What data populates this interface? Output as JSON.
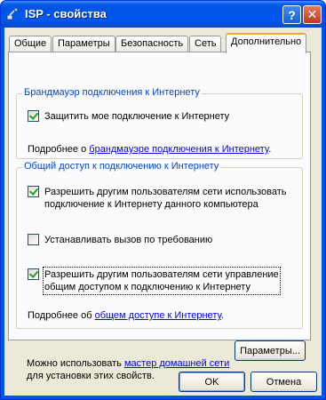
{
  "window": {
    "title": "ISP - свойства",
    "help_label": "?",
    "close_label": "✕"
  },
  "tabs": [
    {
      "label": "Общие"
    },
    {
      "label": "Параметры"
    },
    {
      "label": "Безопасность"
    },
    {
      "label": "Сеть"
    },
    {
      "label": "Дополнительно"
    }
  ],
  "firewall": {
    "title": "Брандмауэр подключения к Интернету",
    "protect_label": "Защитить мое подключение к Интернету",
    "protect_checked": true,
    "more_prefix": "Подробнее о ",
    "more_link": "брандмауэре подключения к Интернету",
    "more_suffix": "."
  },
  "sharing": {
    "title": "Общий доступ к подключению к Интернету",
    "allow_line1": "Разрешить другим пользователям сети использовать",
    "allow_line2": "подключение к Интернету данного компьютера",
    "allow_checked": true,
    "demand_label": "Устанавливать вызов по требованию",
    "demand_checked": false,
    "control_line1": "Разрешить другим пользователям сети управление",
    "control_line2": "общим доступом к подключению к Интернету",
    "control_checked": true,
    "more_prefix": "Подробнее об ",
    "more_link": "общем доступе к Интернету",
    "more_suffix": "."
  },
  "footer": {
    "wizard_prefix": "Можно использовать ",
    "wizard_link": "мастер домашней сети",
    "wizard_line2": "для установки этих свойств.",
    "settings_button": "Параметры..."
  },
  "buttons": {
    "ok": "OK",
    "cancel": "Отмена"
  }
}
